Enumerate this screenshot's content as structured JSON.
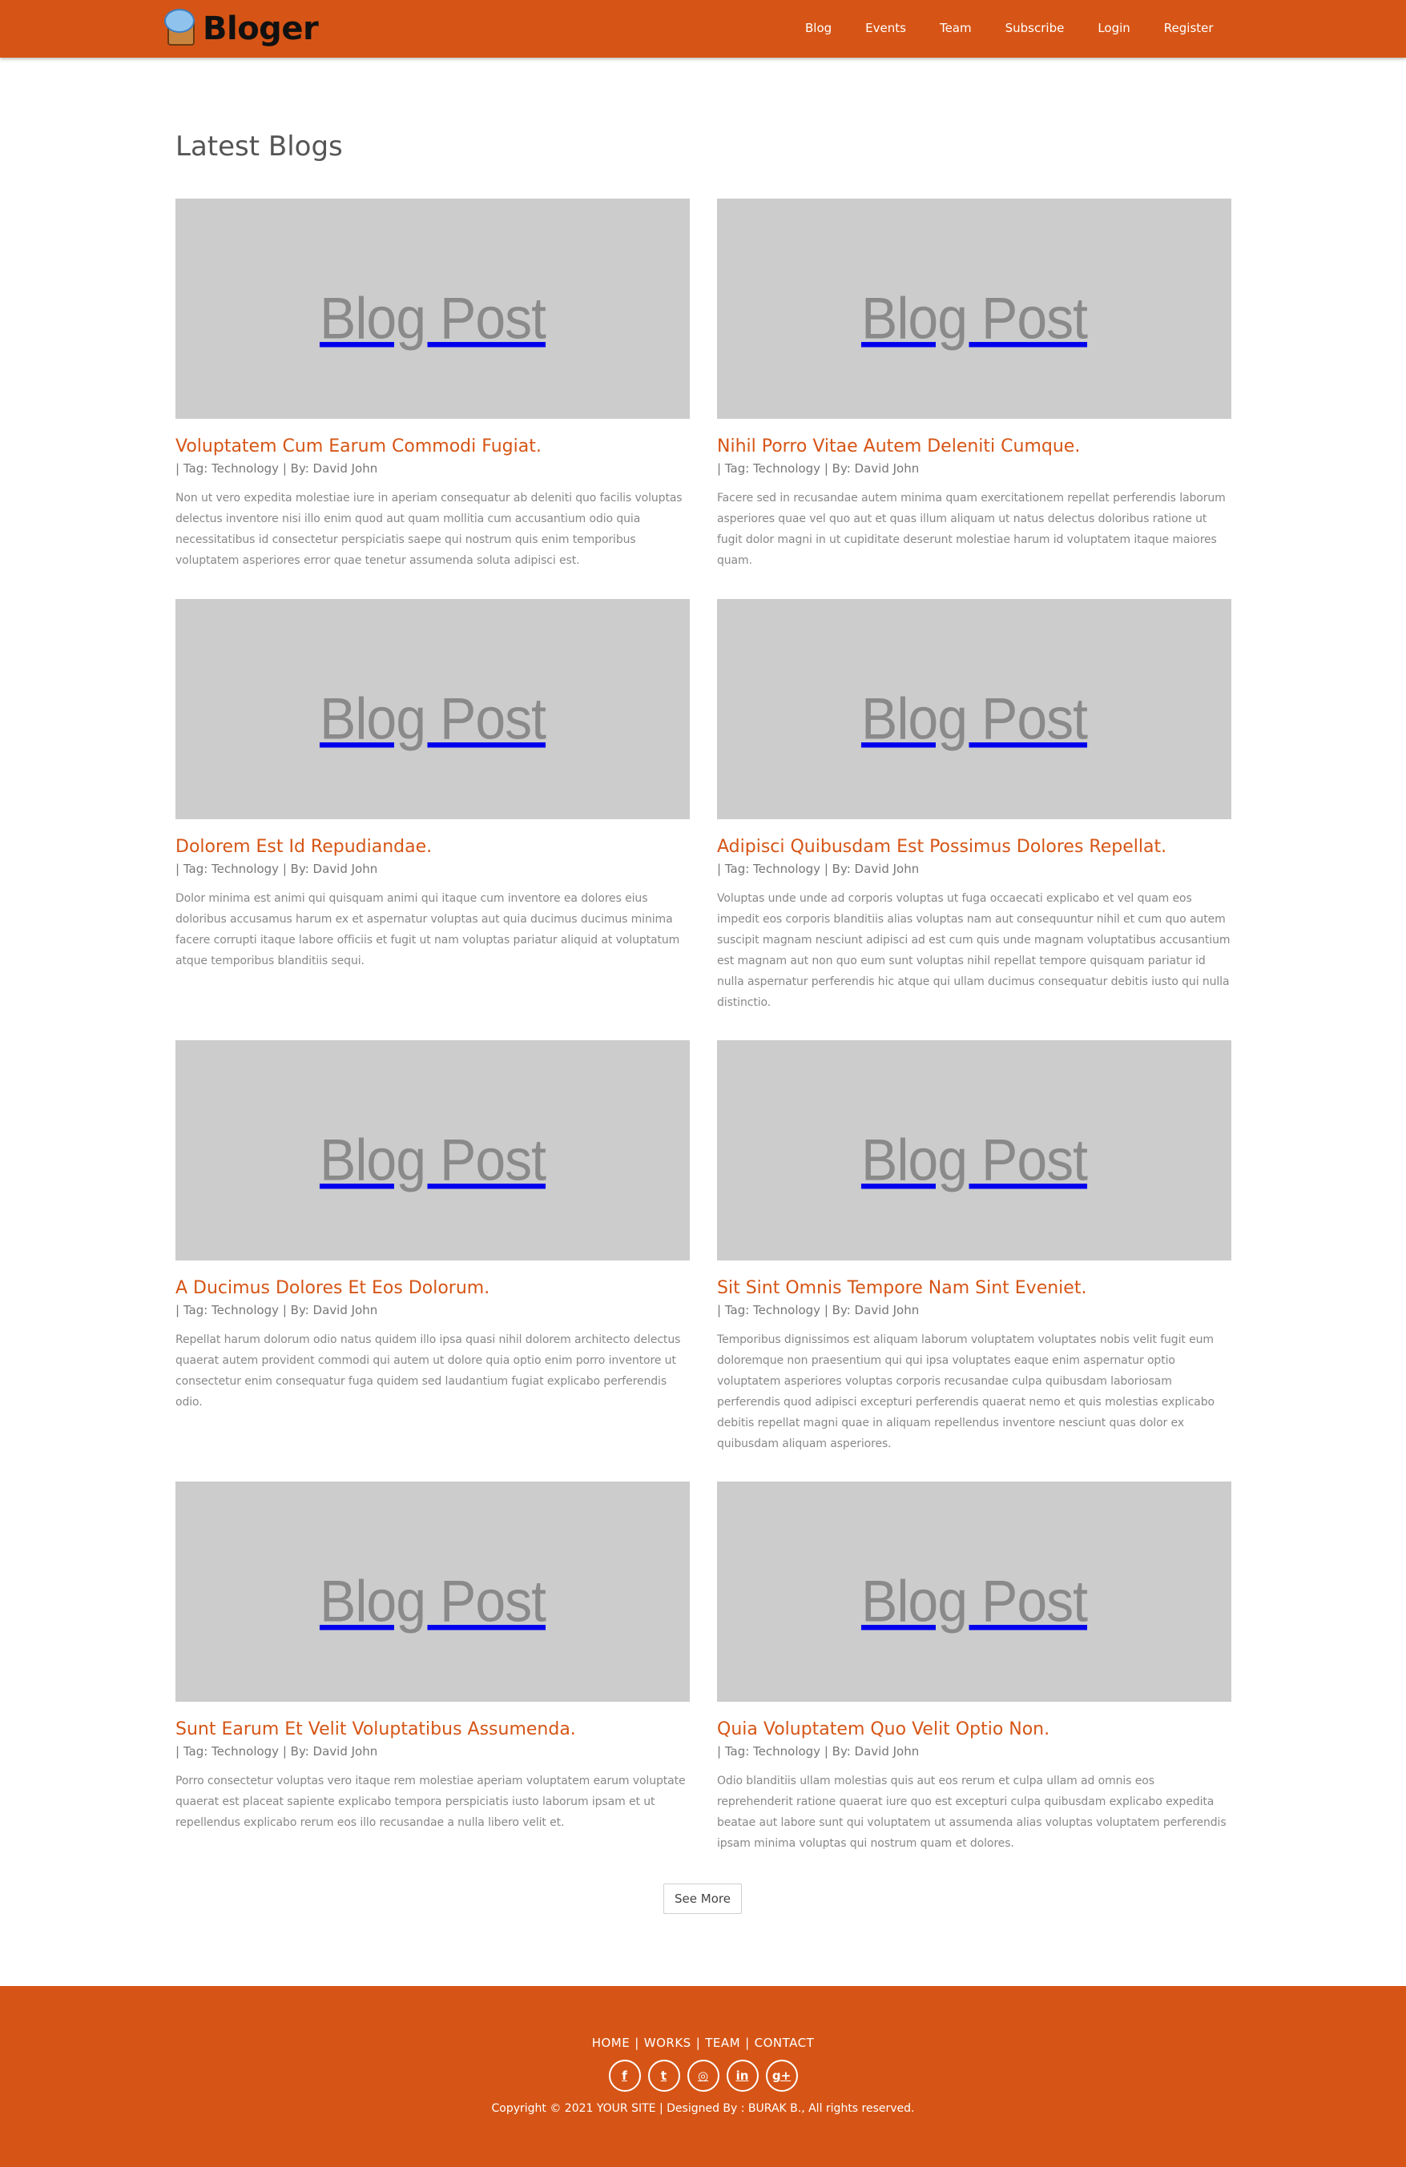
{
  "brand": {
    "name": "Bloger",
    "logo_icon": "speech-bubble-book-icon"
  },
  "nav": [
    "Blog",
    "Events",
    "Team",
    "Subscribe",
    "Login",
    "Register"
  ],
  "section_title": "Latest Blogs",
  "image_placeholder": "Blog Post",
  "posts": [
    {
      "title": "Voluptatem Cum Earum Commodi Fugiat.",
      "meta": "| Tag: Technology | By: David John",
      "body": "Non ut vero expedita molestiae iure in aperiam consequatur ab deleniti quo facilis voluptas delectus inventore nisi illo enim quod aut quam mollitia cum accusantium odio quia necessitatibus id consectetur perspiciatis saepe qui nostrum quis enim temporibus voluptatem asperiores error quae tenetur assumenda soluta adipisci est."
    },
    {
      "title": "Nihil Porro Vitae Autem Deleniti Cumque.",
      "meta": "| Tag: Technology | By: David John",
      "body": "Facere sed in recusandae autem minima quam exercitationem repellat perferendis laborum asperiores quae vel quo aut et quas illum aliquam ut natus delectus doloribus ratione ut fugit dolor magni in ut cupiditate deserunt molestiae harum id voluptatem itaque maiores quam."
    },
    {
      "title": "Dolorem Est Id Repudiandae.",
      "meta": "| Tag: Technology | By: David John",
      "body": "Dolor minima est animi qui quisquam animi qui itaque cum inventore ea dolores eius doloribus accusamus harum ex et aspernatur voluptas aut quia ducimus ducimus minima facere corrupti itaque labore officiis et fugit ut nam voluptas pariatur aliquid at voluptatum atque temporibus blanditiis sequi."
    },
    {
      "title": "Adipisci Quibusdam Est Possimus Dolores Repellat.",
      "meta": "| Tag: Technology | By: David John",
      "body": "Voluptas unde unde ad corporis voluptas ut fuga occaecati explicabo et vel quam eos impedit eos corporis blanditiis alias voluptas nam aut consequuntur nihil et cum quo autem suscipit magnam nesciunt adipisci ad est cum quis unde magnam voluptatibus accusantium est magnam aut non quo eum sunt voluptas nihil repellat tempore quisquam pariatur id nulla aspernatur perferendis hic atque qui ullam ducimus consequatur debitis iusto qui nulla distinctio."
    },
    {
      "title": "A Ducimus Dolores Et Eos Dolorum.",
      "meta": "| Tag: Technology | By: David John",
      "body": "Repellat harum dolorum odio natus quidem illo ipsa quasi nihil dolorem architecto delectus quaerat autem provident commodi qui autem ut dolore quia optio enim porro inventore ut consectetur enim consequatur fuga quidem sed laudantium fugiat explicabo perferendis odio."
    },
    {
      "title": "Sit Sint Omnis Tempore Nam Sint Eveniet.",
      "meta": "| Tag: Technology | By: David John",
      "body": "Temporibus dignissimos est aliquam laborum voluptatem voluptates nobis velit fugit eum doloremque non praesentium qui qui ipsa voluptates eaque enim aspernatur optio voluptatem asperiores voluptas corporis recusandae culpa quibusdam laboriosam perferendis quod adipisci excepturi perferendis quaerat nemo et quis molestias explicabo debitis repellat magni quae in aliquam repellendus inventore nesciunt quas dolor ex quibusdam aliquam asperiores."
    },
    {
      "title": "Sunt Earum Et Velit Voluptatibus Assumenda.",
      "meta": "| Tag: Technology | By: David John",
      "body": "Porro consectetur voluptas vero itaque rem molestiae aperiam voluptatem earum voluptate quaerat est placeat sapiente explicabo tempora perspiciatis iusto laborum ipsam et ut repellendus explicabo rerum eos illo recusandae a nulla libero velit et."
    },
    {
      "title": "Quia Voluptatem Quo Velit Optio Non.",
      "meta": "| Tag: Technology | By: David John",
      "body": "Odio blanditiis ullam molestias quis aut eos rerum et culpa ullam ad omnis eos reprehenderit ratione quaerat iure quo est excepturi culpa quibusdam explicabo expedita beatae aut labore sunt qui voluptatem ut assumenda alias voluptas voluptatem perferendis ipsam minima voluptas qui nostrum quam et dolores."
    }
  ],
  "see_more": "See More",
  "footer": {
    "links": [
      "HOME",
      "WORKS",
      "TEAM",
      "CONTACT"
    ],
    "separator": "|",
    "socials": [
      {
        "icon": "facebook-icon",
        "glyph": "f"
      },
      {
        "icon": "twitter-icon",
        "glyph": "t"
      },
      {
        "icon": "dribbble-icon",
        "glyph": "◎"
      },
      {
        "icon": "linkedin-icon",
        "glyph": "in"
      },
      {
        "icon": "google-plus-icon",
        "glyph": "g+"
      }
    ],
    "copyright": "Copyright © 2021 YOUR SITE | Designed By : BURAK B., All rights reserved."
  },
  "colors": {
    "accent": "#d65516",
    "placeholder_bg": "#cccccc",
    "placeholder_text": "#8a8a8a"
  }
}
